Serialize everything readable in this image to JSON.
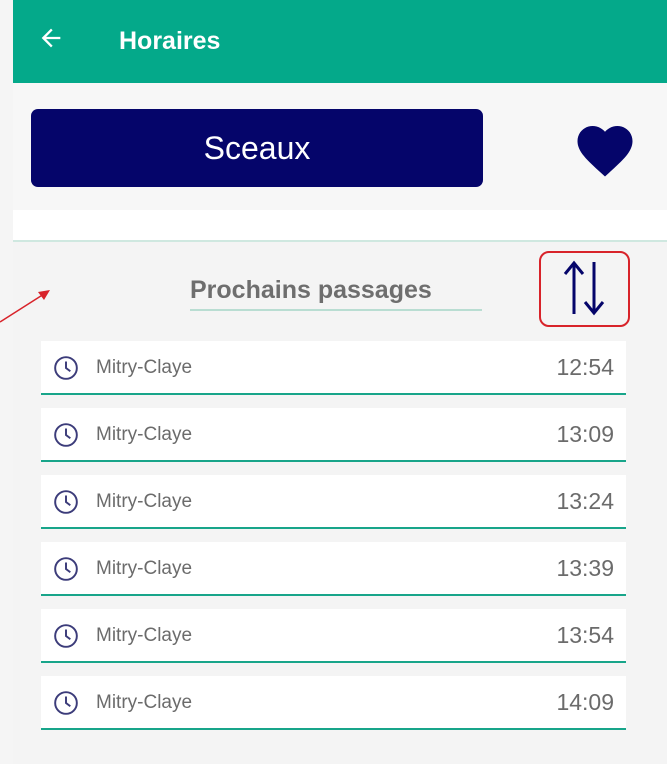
{
  "appbar": {
    "title": "Horaires",
    "color": "#04a98a"
  },
  "stop": {
    "name": "Sceaux",
    "color": "#05056a"
  },
  "section": {
    "title": "Prochains passages"
  },
  "departures": [
    {
      "destination": "Mitry-Claye",
      "time": "12:54"
    },
    {
      "destination": "Mitry-Claye",
      "time": "13:09"
    },
    {
      "destination": "Mitry-Claye",
      "time": "13:24"
    },
    {
      "destination": "Mitry-Claye",
      "time": "13:39"
    },
    {
      "destination": "Mitry-Claye",
      "time": "13:54"
    },
    {
      "destination": "Mitry-Claye",
      "time": "14:09"
    }
  ],
  "icons": {
    "back": "arrow-left-icon",
    "favorite": "heart-icon",
    "sort": "sort-arrows-icon",
    "clock": "clock-icon"
  },
  "annotation_color": "#d8232a"
}
